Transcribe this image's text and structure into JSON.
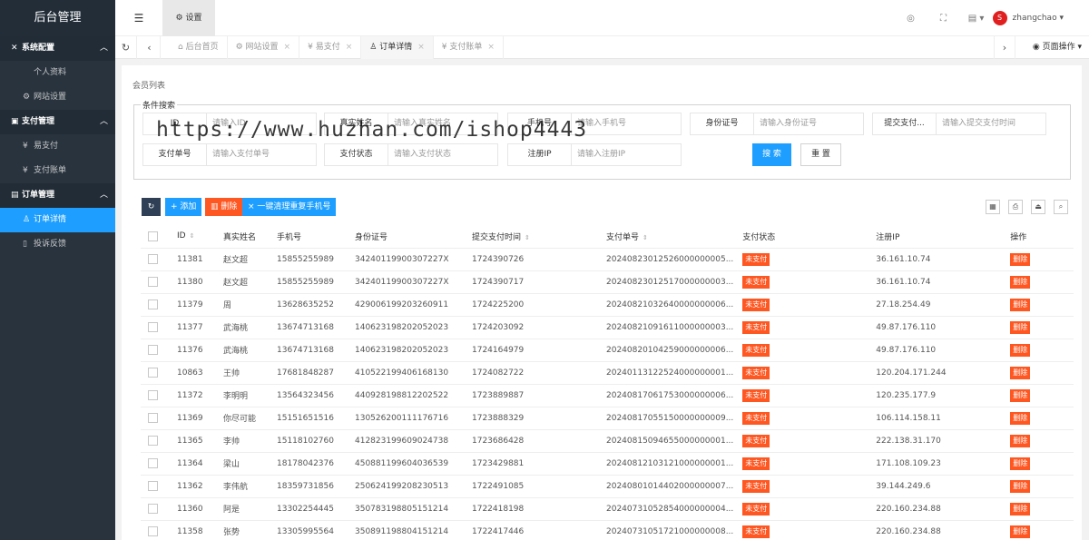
{
  "app": {
    "title": "后台管理"
  },
  "sidebar": {
    "groups": [
      {
        "label": "系统配置",
        "items": [
          {
            "label": "个人资料"
          },
          {
            "label": "网站设置"
          }
        ]
      },
      {
        "label": "支付管理",
        "items": [
          {
            "label": "易支付"
          },
          {
            "label": "支付账单"
          }
        ]
      },
      {
        "label": "订单管理",
        "items": [
          {
            "label": "订单详情"
          },
          {
            "label": "投诉反馈"
          }
        ]
      }
    ]
  },
  "header": {
    "settings_tab": "设置",
    "username": "zhangchao",
    "avatar_text": "S"
  },
  "tabs": [
    {
      "label": "后台首页"
    },
    {
      "label": "网站设置"
    },
    {
      "label": "易支付"
    },
    {
      "label": "订单详情"
    },
    {
      "label": "支付账单"
    }
  ],
  "page_ops": "页面操作",
  "watermark": "https://www.huzhan.com/ishop4443",
  "card_title": "会员列表",
  "search": {
    "legend": "条件搜索",
    "fields": [
      {
        "label": "ID",
        "placeholder": "请输入ID"
      },
      {
        "label": "真实姓名",
        "placeholder": "请输入真实姓名"
      },
      {
        "label": "手机号",
        "placeholder": "请输入手机号"
      },
      {
        "label": "身份证号",
        "placeholder": "请输入身份证号"
      },
      {
        "label": "提交支付...",
        "placeholder": "请输入提交支付时间"
      },
      {
        "label": "支付单号",
        "placeholder": "请输入支付单号"
      },
      {
        "label": "支付状态",
        "placeholder": "请输入支付状态"
      },
      {
        "label": "注册IP",
        "placeholder": "请输入注册IP"
      }
    ],
    "search_btn": "搜 索",
    "reset_btn": "重 置"
  },
  "toolbar": {
    "add": "+ 添加",
    "delete": "删除",
    "dedupe": "× 一键清理重复手机号"
  },
  "colors": {
    "primary": "#1e9fff",
    "danger": "#ff5722",
    "sidebar": "#28333e",
    "toolbar_dark": "#2f4056"
  },
  "table": {
    "headers": [
      "ID",
      "真实姓名",
      "手机号",
      "身份证号",
      "提交支付时间",
      "支付单号",
      "支付状态",
      "注册IP",
      "操作"
    ],
    "rows": [
      [
        "11381",
        "赵文超",
        "15855255989",
        "34240119900307227X",
        "1724390726",
        "20240823012526000000005...",
        "未支付",
        "36.161.10.74",
        "删除"
      ],
      [
        "11380",
        "赵文超",
        "15855255989",
        "34240119900307227X",
        "1724390717",
        "20240823012517000000003...",
        "未支付",
        "36.161.10.74",
        "删除"
      ],
      [
        "11379",
        "周",
        "13628635252",
        "429006199203260911",
        "1724225200",
        "20240821032640000000006...",
        "未支付",
        "27.18.254.49",
        "删除"
      ],
      [
        "11377",
        "武海桃",
        "13674713168",
        "140623198202052023",
        "1724203092",
        "20240821091611000000003...",
        "未支付",
        "49.87.176.110",
        "删除"
      ],
      [
        "11376",
        "武海桃",
        "13674713168",
        "140623198202052023",
        "1724164979",
        "20240820104259000000006...",
        "未支付",
        "49.87.176.110",
        "删除"
      ],
      [
        "10863",
        "王帅",
        "17681848287",
        "410522199406168130",
        "1724082722",
        "20240113122524000000001...",
        "未支付",
        "120.204.171.244",
        "删除"
      ],
      [
        "11372",
        "李明明",
        "13564323456",
        "440928198812202522",
        "1723889887",
        "20240817061753000000006...",
        "未支付",
        "120.235.177.9",
        "删除"
      ],
      [
        "11369",
        "你尽可能",
        "15151651516",
        "130526200111176716",
        "1723888329",
        "20240817055150000000009...",
        "未支付",
        "106.114.158.11",
        "删除"
      ],
      [
        "11365",
        "李帅",
        "15118102760",
        "412823199609024738",
        "1723686428",
        "20240815094655000000001...",
        "未支付",
        "222.138.31.170",
        "删除"
      ],
      [
        "11364",
        "梁山",
        "18178042376",
        "450881199604036539",
        "1723429881",
        "20240812103121000000001...",
        "未支付",
        "171.108.109.23",
        "删除"
      ],
      [
        "11362",
        "李伟航",
        "18359731856",
        "250624199208230513",
        "1722491085",
        "20240801014402000000007...",
        "未支付",
        "39.144.249.6",
        "删除"
      ],
      [
        "11360",
        "阿是",
        "13302254445",
        "350783198805151214",
        "1722418198",
        "20240731052854000000004...",
        "未支付",
        "220.160.234.88",
        "删除"
      ],
      [
        "11358",
        "张势",
        "13305995564",
        "350891198804151214",
        "1722417446",
        "20240731051721000000008...",
        "未支付",
        "220.160.234.88",
        "删除"
      ]
    ]
  }
}
